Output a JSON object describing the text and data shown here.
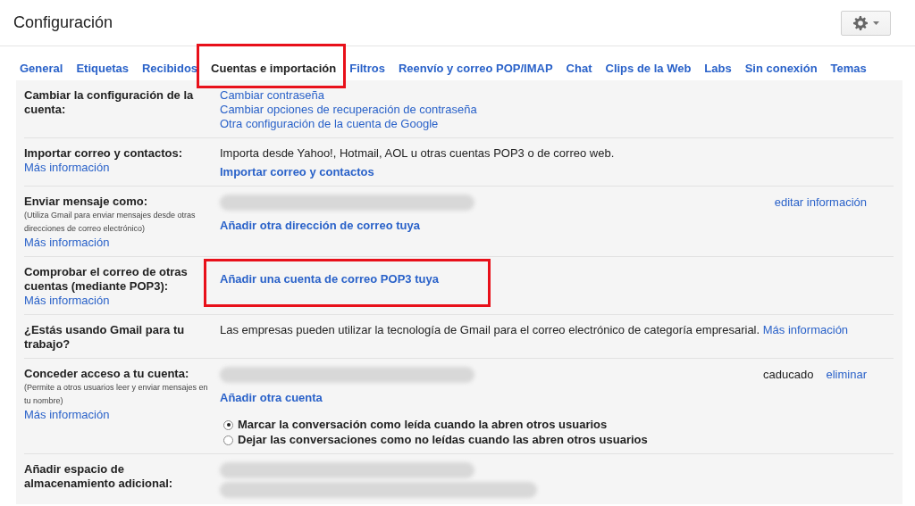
{
  "header": {
    "title": "Configuración"
  },
  "tabs": [
    {
      "label": "General",
      "selected": false,
      "highlighted": false
    },
    {
      "label": "Etiquetas",
      "selected": false,
      "highlighted": false
    },
    {
      "label": "Recibidos",
      "selected": false,
      "highlighted": false
    },
    {
      "label": "Cuentas e importación",
      "selected": true,
      "highlighted": true
    },
    {
      "label": "Filtros",
      "selected": false,
      "highlighted": false
    },
    {
      "label": "Reenvío y correo POP/IMAP",
      "selected": false,
      "highlighted": false
    },
    {
      "label": "Chat",
      "selected": false,
      "highlighted": false
    },
    {
      "label": "Clips de la Web",
      "selected": false,
      "highlighted": false
    },
    {
      "label": "Labs",
      "selected": false,
      "highlighted": false
    },
    {
      "label": "Sin conexión",
      "selected": false,
      "highlighted": false
    },
    {
      "label": "Temas",
      "selected": false,
      "highlighted": false
    }
  ],
  "settings": [
    {
      "label": "Cambiar la configuración de la cuenta:",
      "items": [
        {
          "kind": "link",
          "text": "Cambiar contraseña"
        },
        {
          "kind": "link",
          "text": "Cambiar opciones de recuperación de contraseña"
        },
        {
          "kind": "link",
          "text": "Otra configuración de la cuenta de Google"
        }
      ]
    },
    {
      "label": "Importar correo y contactos:",
      "more": "Más información",
      "items": [
        {
          "kind": "text",
          "text": "Importa desde Yahoo!, Hotmail, AOL u otras cuentas POP3 o de correo web."
        },
        {
          "kind": "action",
          "text": "Importar correo y contactos"
        }
      ]
    },
    {
      "label": "Enviar mensaje como:",
      "note": "(Utiliza Gmail para enviar mensajes desde otras direcciones de correo electrónico)",
      "more": "Más información",
      "items": [
        {
          "kind": "redacted",
          "extra": [
            {
              "kind": "link",
              "text": "editar información"
            }
          ]
        },
        {
          "kind": "action",
          "text": "Añadir otra dirección de correo tuya"
        }
      ]
    },
    {
      "label": "Comprobar el correo de otras cuentas (mediante POP3):",
      "more": "Más información",
      "items": [
        {
          "kind": "action",
          "text": "Añadir una cuenta de correo POP3 tuya",
          "highlighted": true
        }
      ]
    },
    {
      "label": "¿Estás usando Gmail para tu trabajo?",
      "items": [
        {
          "kind": "text",
          "text": "Las empresas pueden utilizar la tecnología de Gmail para el correo electrónico de categoría empresarial.",
          "link": "Más información"
        }
      ]
    },
    {
      "label": "Conceder acceso a tu cuenta:",
      "note": "(Permite a otros usuarios leer y enviar mensajes en tu nombre)",
      "more": "Más información",
      "items": [
        {
          "kind": "redacted",
          "extra": [
            {
              "kind": "text",
              "text": "caducado"
            },
            {
              "kind": "link",
              "text": "eliminar"
            }
          ]
        },
        {
          "kind": "action",
          "text": "Añadir otra cuenta"
        },
        {
          "kind": "radio",
          "text": "Marcar la conversación como leída cuando la abren otros usuarios",
          "selected": true
        },
        {
          "kind": "radio",
          "text": "Dejar las conversaciones como no leídas cuando las abren otros usuarios",
          "selected": false
        }
      ]
    },
    {
      "label": "Añadir espacio de almacenamiento adicional:",
      "items": [
        {
          "kind": "redacted_block"
        }
      ]
    }
  ]
}
